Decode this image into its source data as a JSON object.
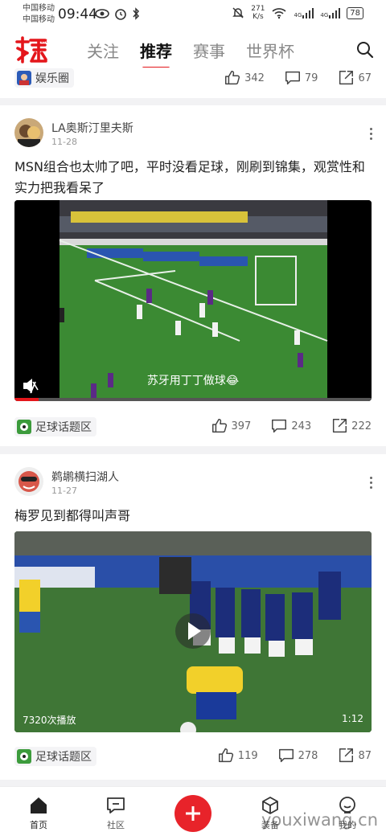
{
  "status_bar": {
    "carrier_1": "中国移动",
    "carrier_2": "中国移动",
    "time": "09:44",
    "net_speed_value": "271",
    "net_speed_unit": "K/s",
    "signal_1": "4G",
    "signal_2": "4G",
    "battery": "78"
  },
  "header": {
    "logo_icon": "hupu-logo-icon",
    "tabs": [
      {
        "label": "关注",
        "active": false
      },
      {
        "label": "推荐",
        "active": true
      },
      {
        "label": "赛事",
        "active": false
      },
      {
        "label": "世界杯",
        "active": false
      }
    ]
  },
  "top_card": {
    "tag": "娱乐圈",
    "likes": "342",
    "comments": "79",
    "shares": "67"
  },
  "posts": [
    {
      "username": "LA奥斯汀里夫斯",
      "date": "11-28",
      "text": "MSN组合也太帅了吧，平时没看足球，刚刷到锦集，观赏性和实力把我看呆了",
      "video_caption": "苏牙用丁丁做球😂",
      "tag": "足球话题区",
      "likes": "397",
      "comments": "243",
      "shares": "222"
    },
    {
      "username": "鹈鹕横扫湖人",
      "date": "11-27",
      "text": "梅罗见到都得叫声哥",
      "plays": "7320次播放",
      "duration": "1:12",
      "tag": "足球话题区",
      "likes": "119",
      "comments": "278",
      "shares": "87"
    }
  ],
  "bottom_nav": [
    {
      "label": "首页",
      "icon": "home-icon"
    },
    {
      "label": "社区",
      "icon": "community-icon"
    },
    {
      "label": "",
      "icon": "plus-icon"
    },
    {
      "label": "装备",
      "icon": "cube-icon"
    },
    {
      "label": "我的",
      "icon": "profile-icon"
    }
  ],
  "watermark": "youxiwang.cn",
  "colors": {
    "accent": "#e4161b",
    "pitch": "#3f8a34"
  }
}
